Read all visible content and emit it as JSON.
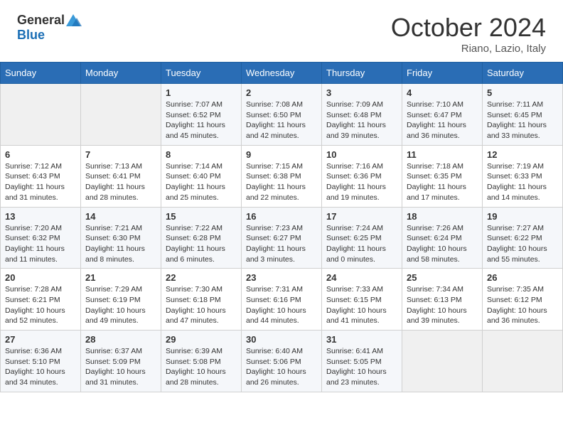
{
  "header": {
    "logo_general": "General",
    "logo_blue": "Blue",
    "month_title": "October 2024",
    "location": "Riano, Lazio, Italy"
  },
  "weekdays": [
    "Sunday",
    "Monday",
    "Tuesday",
    "Wednesday",
    "Thursday",
    "Friday",
    "Saturday"
  ],
  "weeks": [
    [
      {
        "day": "",
        "sunrise": "",
        "sunset": "",
        "daylight": ""
      },
      {
        "day": "",
        "sunrise": "",
        "sunset": "",
        "daylight": ""
      },
      {
        "day": "1",
        "sunrise": "Sunrise: 7:07 AM",
        "sunset": "Sunset: 6:52 PM",
        "daylight": "Daylight: 11 hours and 45 minutes."
      },
      {
        "day": "2",
        "sunrise": "Sunrise: 7:08 AM",
        "sunset": "Sunset: 6:50 PM",
        "daylight": "Daylight: 11 hours and 42 minutes."
      },
      {
        "day": "3",
        "sunrise": "Sunrise: 7:09 AM",
        "sunset": "Sunset: 6:48 PM",
        "daylight": "Daylight: 11 hours and 39 minutes."
      },
      {
        "day": "4",
        "sunrise": "Sunrise: 7:10 AM",
        "sunset": "Sunset: 6:47 PM",
        "daylight": "Daylight: 11 hours and 36 minutes."
      },
      {
        "day": "5",
        "sunrise": "Sunrise: 7:11 AM",
        "sunset": "Sunset: 6:45 PM",
        "daylight": "Daylight: 11 hours and 33 minutes."
      }
    ],
    [
      {
        "day": "6",
        "sunrise": "Sunrise: 7:12 AM",
        "sunset": "Sunset: 6:43 PM",
        "daylight": "Daylight: 11 hours and 31 minutes."
      },
      {
        "day": "7",
        "sunrise": "Sunrise: 7:13 AM",
        "sunset": "Sunset: 6:41 PM",
        "daylight": "Daylight: 11 hours and 28 minutes."
      },
      {
        "day": "8",
        "sunrise": "Sunrise: 7:14 AM",
        "sunset": "Sunset: 6:40 PM",
        "daylight": "Daylight: 11 hours and 25 minutes."
      },
      {
        "day": "9",
        "sunrise": "Sunrise: 7:15 AM",
        "sunset": "Sunset: 6:38 PM",
        "daylight": "Daylight: 11 hours and 22 minutes."
      },
      {
        "day": "10",
        "sunrise": "Sunrise: 7:16 AM",
        "sunset": "Sunset: 6:36 PM",
        "daylight": "Daylight: 11 hours and 19 minutes."
      },
      {
        "day": "11",
        "sunrise": "Sunrise: 7:18 AM",
        "sunset": "Sunset: 6:35 PM",
        "daylight": "Daylight: 11 hours and 17 minutes."
      },
      {
        "day": "12",
        "sunrise": "Sunrise: 7:19 AM",
        "sunset": "Sunset: 6:33 PM",
        "daylight": "Daylight: 11 hours and 14 minutes."
      }
    ],
    [
      {
        "day": "13",
        "sunrise": "Sunrise: 7:20 AM",
        "sunset": "Sunset: 6:32 PM",
        "daylight": "Daylight: 11 hours and 11 minutes."
      },
      {
        "day": "14",
        "sunrise": "Sunrise: 7:21 AM",
        "sunset": "Sunset: 6:30 PM",
        "daylight": "Daylight: 11 hours and 8 minutes."
      },
      {
        "day": "15",
        "sunrise": "Sunrise: 7:22 AM",
        "sunset": "Sunset: 6:28 PM",
        "daylight": "Daylight: 11 hours and 6 minutes."
      },
      {
        "day": "16",
        "sunrise": "Sunrise: 7:23 AM",
        "sunset": "Sunset: 6:27 PM",
        "daylight": "Daylight: 11 hours and 3 minutes."
      },
      {
        "day": "17",
        "sunrise": "Sunrise: 7:24 AM",
        "sunset": "Sunset: 6:25 PM",
        "daylight": "Daylight: 11 hours and 0 minutes."
      },
      {
        "day": "18",
        "sunrise": "Sunrise: 7:26 AM",
        "sunset": "Sunset: 6:24 PM",
        "daylight": "Daylight: 10 hours and 58 minutes."
      },
      {
        "day": "19",
        "sunrise": "Sunrise: 7:27 AM",
        "sunset": "Sunset: 6:22 PM",
        "daylight": "Daylight: 10 hours and 55 minutes."
      }
    ],
    [
      {
        "day": "20",
        "sunrise": "Sunrise: 7:28 AM",
        "sunset": "Sunset: 6:21 PM",
        "daylight": "Daylight: 10 hours and 52 minutes."
      },
      {
        "day": "21",
        "sunrise": "Sunrise: 7:29 AM",
        "sunset": "Sunset: 6:19 PM",
        "daylight": "Daylight: 10 hours and 49 minutes."
      },
      {
        "day": "22",
        "sunrise": "Sunrise: 7:30 AM",
        "sunset": "Sunset: 6:18 PM",
        "daylight": "Daylight: 10 hours and 47 minutes."
      },
      {
        "day": "23",
        "sunrise": "Sunrise: 7:31 AM",
        "sunset": "Sunset: 6:16 PM",
        "daylight": "Daylight: 10 hours and 44 minutes."
      },
      {
        "day": "24",
        "sunrise": "Sunrise: 7:33 AM",
        "sunset": "Sunset: 6:15 PM",
        "daylight": "Daylight: 10 hours and 41 minutes."
      },
      {
        "day": "25",
        "sunrise": "Sunrise: 7:34 AM",
        "sunset": "Sunset: 6:13 PM",
        "daylight": "Daylight: 10 hours and 39 minutes."
      },
      {
        "day": "26",
        "sunrise": "Sunrise: 7:35 AM",
        "sunset": "Sunset: 6:12 PM",
        "daylight": "Daylight: 10 hours and 36 minutes."
      }
    ],
    [
      {
        "day": "27",
        "sunrise": "Sunrise: 6:36 AM",
        "sunset": "Sunset: 5:10 PM",
        "daylight": "Daylight: 10 hours and 34 minutes."
      },
      {
        "day": "28",
        "sunrise": "Sunrise: 6:37 AM",
        "sunset": "Sunset: 5:09 PM",
        "daylight": "Daylight: 10 hours and 31 minutes."
      },
      {
        "day": "29",
        "sunrise": "Sunrise: 6:39 AM",
        "sunset": "Sunset: 5:08 PM",
        "daylight": "Daylight: 10 hours and 28 minutes."
      },
      {
        "day": "30",
        "sunrise": "Sunrise: 6:40 AM",
        "sunset": "Sunset: 5:06 PM",
        "daylight": "Daylight: 10 hours and 26 minutes."
      },
      {
        "day": "31",
        "sunrise": "Sunrise: 6:41 AM",
        "sunset": "Sunset: 5:05 PM",
        "daylight": "Daylight: 10 hours and 23 minutes."
      },
      {
        "day": "",
        "sunrise": "",
        "sunset": "",
        "daylight": ""
      },
      {
        "day": "",
        "sunrise": "",
        "sunset": "",
        "daylight": ""
      }
    ]
  ]
}
